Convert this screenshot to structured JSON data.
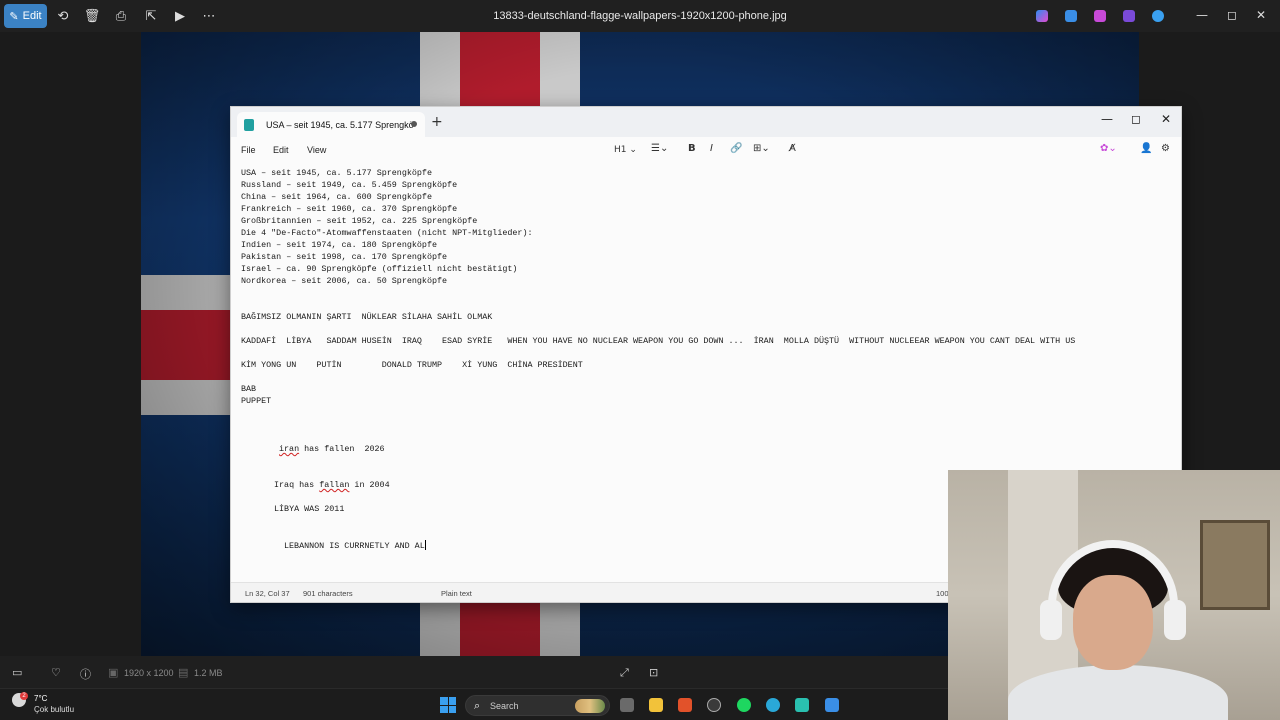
{
  "photos": {
    "edit_label": "Edit",
    "file_title": "13833-deutschland-flagge-wallpapers-1920x1200-phone.jpg",
    "image_size": "1920 x 1200",
    "file_size": "1.2 MB"
  },
  "notepad": {
    "tab_title": "USA – seit 1945, ca. 5.177 Sprengkö",
    "menu": [
      "File",
      "Edit",
      "View"
    ],
    "heading_select": "H1",
    "lines": [
      "USA – seit 1945, ca. 5.177 Sprengköpfe",
      "Russland – seit 1949, ca. 5.459 Sprengköpfe",
      "China – seit 1964, ca. 600 Sprengköpfe",
      "Frankreich – seit 1960, ca. 370 Sprengköpfe",
      "Großbritannien – seit 1952, ca. 225 Sprengköpfe",
      "Die 4 \"De-Facto\"-Atomwaffenstaaten (nicht NPT-Mitglieder):",
      "Indien – seit 1974, ca. 180 Sprengköpfe",
      "Pakistan – seit 1998, ca. 170 Sprengköpfe",
      "Israel – ca. 90 Sprengköpfe (offiziell nicht bestätigt)",
      "Nordkorea – seit 2006, ca. 50 Sprengköpfe",
      "BAĞIMSIZ OLMANIN ŞARTI  NÜKLEAR SİLAHA SAHİL OLMAK",
      "KADDAFİ  LİBYA   SADDAM HUSEİN  IRAQ    ESAD SYRİE   WHEN YOU HAVE NO NUCLEAR WEAPON YOU GO DOWN ...  İRAN  MOLLA DÜŞTÜ  WITHOUT NUCLEEAR WEAPON YOU CANT DEAL WITH US",
      "KİM YONG UN    PUTİN        DONALD TRUMP    Xİ YUNG  CHİNA PRESİDENT",
      "BAB",
      "PUPPET"
    ],
    "line_iran_a": "iran",
    "line_iran_b": " has fallen  2026",
    "line_iraq_a": "Iraq has ",
    "line_iraq_b": "fallan",
    "line_iraq_c": " in 2004",
    "line_libya": "LİBYA WAS 2011",
    "line_lebanon": "LEBANNON IS CURRNETLY AND AL",
    "status": {
      "position": "Ln 32, Col 37",
      "chars": "901 characters",
      "format": "Plain text",
      "zoom": "100"
    }
  },
  "taskbar": {
    "temp": "7°C",
    "condition": "Çok bulutlu",
    "weather_badge": "2",
    "search_placeholder": "Search"
  }
}
